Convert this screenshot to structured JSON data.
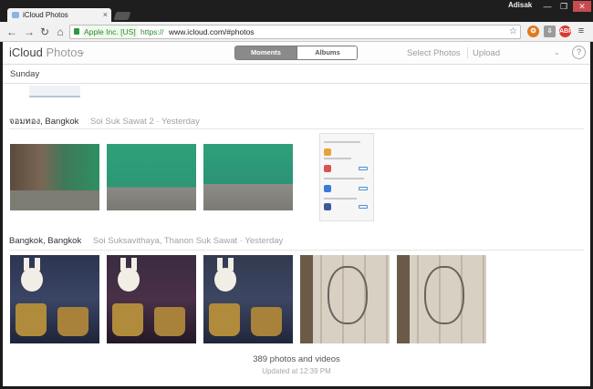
{
  "browser": {
    "tab_title": "iCloud Photos",
    "tab_close": "×",
    "profile": "Adisak",
    "window_controls": {
      "minimize": "—",
      "maximize": "❐",
      "close": "✕"
    },
    "nav": {
      "back": "←",
      "forward": "→",
      "reload": "↻",
      "home": "⌂"
    },
    "ev_cert": "Apple Inc. [US]",
    "url_scheme": "https://",
    "url_rest": "www.icloud.com/#photos",
    "star": "☆",
    "extensions": [
      "✪",
      "⇩",
      "ABP"
    ],
    "menu": "≡"
  },
  "app": {
    "brand_main": "iCloud",
    "brand_sub": "Photos",
    "brand_chevron": "⌄",
    "segments": {
      "moments": "Moments",
      "albums": "Albums"
    },
    "select_photos": "Select Photos",
    "upload": "Upload",
    "header_chevron": "⌄",
    "help": "?"
  },
  "moments": {
    "first_title": "Sunday",
    "groups": [
      {
        "place": "จอมทอง, Bangkok",
        "meta": "Soi Suk Sawat 2 · Yesterday"
      },
      {
        "place": "Bangkok, Bangkok",
        "meta": "Soi Suksavithaya, Thanon Suk Sawat · Yesterday"
      }
    ]
  },
  "footer": {
    "count": "389 photos and videos",
    "updated": "Updated at 12:39 PM"
  }
}
